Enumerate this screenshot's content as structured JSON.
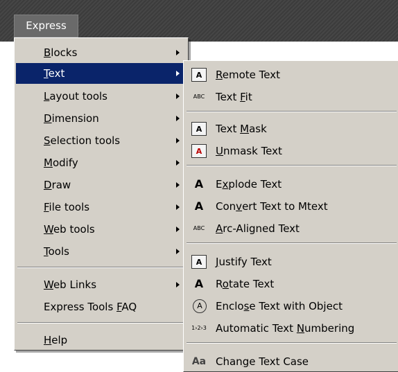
{
  "menubar": {
    "title": "Express"
  },
  "main_menu": {
    "items": [
      {
        "pre": "",
        "key": "B",
        "post": "locks",
        "submenu": true
      },
      {
        "pre": "",
        "key": "T",
        "post": "ext",
        "submenu": true,
        "selected": true
      },
      {
        "pre": "",
        "key": "L",
        "post": "ayout tools",
        "submenu": true
      },
      {
        "pre": "",
        "key": "D",
        "post": "imension",
        "submenu": true
      },
      {
        "pre": "",
        "key": "S",
        "post": "election tools",
        "submenu": true
      },
      {
        "pre": "",
        "key": "M",
        "post": "odify",
        "submenu": true
      },
      {
        "pre": "",
        "key": "D",
        "post": "raw",
        "submenu": true
      },
      {
        "pre": "",
        "key": "F",
        "post": "ile tools",
        "submenu": true
      },
      {
        "pre": "",
        "key": "W",
        "post": "eb tools",
        "submenu": true
      },
      {
        "pre": "",
        "key": "T",
        "post": "ools",
        "submenu": true
      },
      {
        "pre": "",
        "key": "W",
        "post": "eb Links",
        "submenu": true
      },
      {
        "pre": "Express Tools ",
        "key": "F",
        "post": "AQ",
        "submenu": false
      },
      {
        "pre": "",
        "key": "H",
        "post": "elp",
        "submenu": false
      }
    ]
  },
  "text_submenu": {
    "items": [
      {
        "icon": "remote-text-icon",
        "glyph": "A",
        "pre": "",
        "key": "R",
        "post": "emote Text"
      },
      {
        "icon": "text-fit-icon",
        "glyph": "ABC",
        "pre": "Text ",
        "key": "F",
        "post": "it"
      },
      {
        "icon": "text-mask-icon",
        "glyph": "A",
        "pre": "Text ",
        "key": "M",
        "post": "ask"
      },
      {
        "icon": "unmask-text-icon",
        "glyph": "A",
        "pre": "",
        "key": "U",
        "post": "nmask Text"
      },
      {
        "icon": "explode-text-icon",
        "glyph": "A",
        "pre": "E",
        "key": "x",
        "post": "plode Text"
      },
      {
        "icon": "convert-text-icon",
        "glyph": "A",
        "pre": "Con",
        "key": "v",
        "post": "ert Text to Mtext"
      },
      {
        "icon": "arc-aligned-text-icon",
        "glyph": "ABC",
        "pre": "",
        "key": "A",
        "post": "rc-Aligned Text"
      },
      {
        "icon": "justify-text-icon",
        "glyph": "A",
        "pre": "",
        "key": "J",
        "post": "ustify Text"
      },
      {
        "icon": "rotate-text-icon",
        "glyph": "A",
        "pre": "R",
        "key": "o",
        "post": "tate Text"
      },
      {
        "icon": "enclose-text-icon",
        "glyph": "A",
        "pre": "Enclo",
        "key": "s",
        "post": "e Text with Object"
      },
      {
        "icon": "text-numbering-icon",
        "glyph": "1›2›3",
        "pre": "Automatic Text ",
        "key": "N",
        "post": "umbering"
      },
      {
        "icon": "change-case-icon",
        "glyph": "Aa",
        "pre": "Chan",
        "key": "g",
        "post": "e Text Case"
      }
    ]
  },
  "colors": {
    "menu_bg": "#d4d0c8",
    "highlight": "#0a246a",
    "menubar_bg": "#3c3c3c"
  }
}
